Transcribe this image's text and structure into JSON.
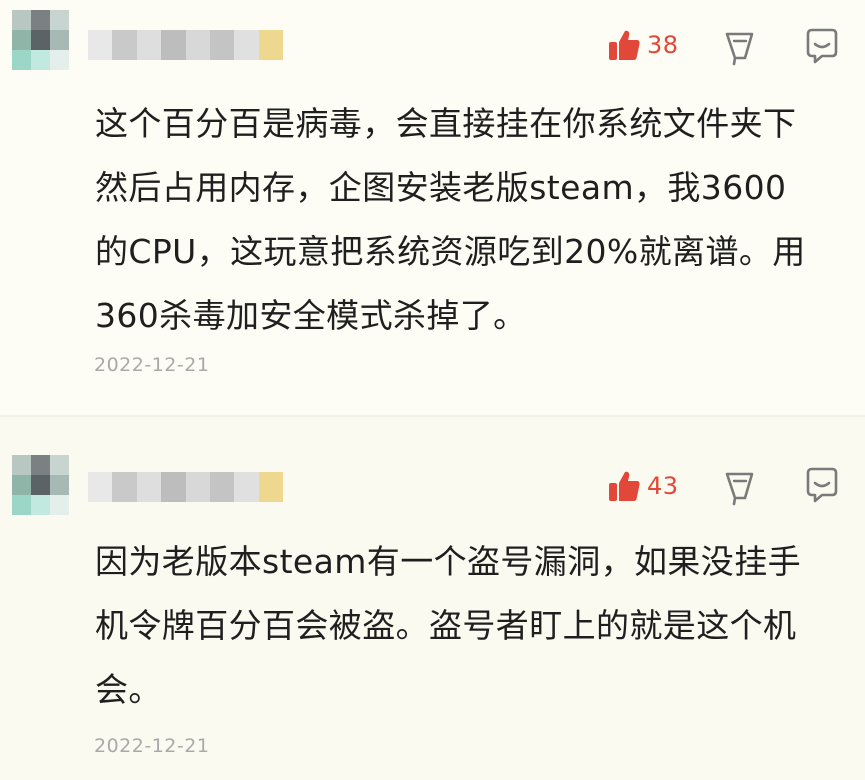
{
  "comments": [
    {
      "likes": "38",
      "text": "这个百分百是病毒，会直接挂在你系统文件夹下\n然后占用内存，企图安装老版steam，我3600\n的CPU，这玩意把系统资源吃到20%就离谱。用\n360杀毒加安全模式杀掉了。",
      "date": "2022-12-21"
    },
    {
      "likes": "43",
      "text": "因为老版本steam有一个盗号漏洞，如果没挂手\n机令牌百分百会被盗。盗号者盯上的就是这个机\n会。",
      "date": "2022-12-21"
    }
  ],
  "colors": {
    "like_red": "#e2483a",
    "date_gray": "#a9a9a9",
    "icon_gray": "#7a7a7a"
  },
  "icons": [
    "thumb-up-icon",
    "flag-icon",
    "chat-icon"
  ]
}
